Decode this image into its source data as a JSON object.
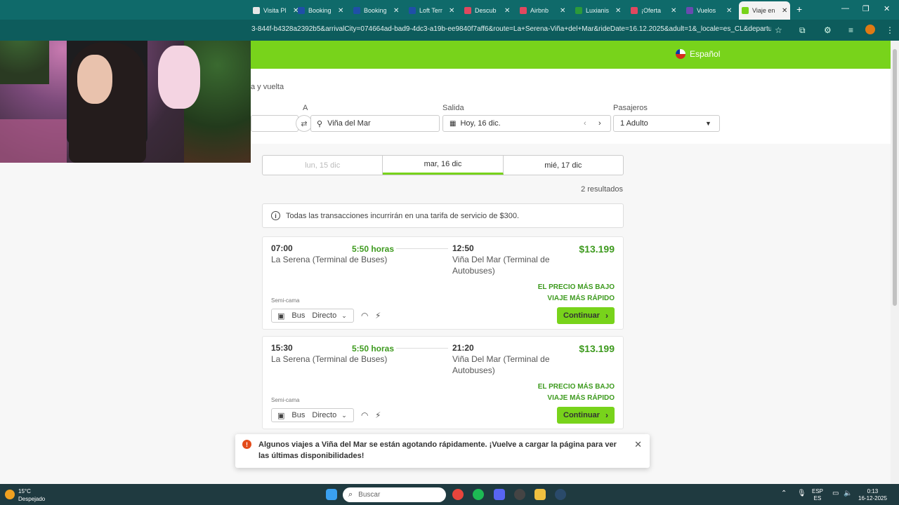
{
  "browser": {
    "tabs": [
      {
        "title": "Visita Pl",
        "color": "#e6e6e6"
      },
      {
        "title": "Booking",
        "color": "#1f4fa8"
      },
      {
        "title": "Booking",
        "color": "#1f4fa8"
      },
      {
        "title": "Loft Terr",
        "color": "#1f4fa8"
      },
      {
        "title": "Descub",
        "color": "#e0485f"
      },
      {
        "title": "Airbnb",
        "color": "#e0485f"
      },
      {
        "title": "Luxianis",
        "color": "#2c9a3a"
      },
      {
        "title": "¡Oferta",
        "color": "#e0485f"
      },
      {
        "title": "Vuelos",
        "color": "#6a4ab0"
      },
      {
        "title": "Viaje en",
        "color": "#78d31b"
      }
    ],
    "url": "3-844f-b4328a2392b5&arrivalCity=074664ad-bad9-4dc3-a19b-ee9840f7aff6&route=La+Serena-Viña+del+Mar&rideDate=16.12.2025&adult=1&_locale=es_CL&departureCoun..."
  },
  "header": {
    "language": "Español"
  },
  "search": {
    "trip_type": "a y vuelta",
    "to_label": "A",
    "to_value": "Viña del Mar",
    "departure_label": "Salida",
    "departure_value": "Hoy, 16 dic.",
    "passengers_label": "Pasajeros",
    "passengers_value": "1 Adulto"
  },
  "date_tabs": [
    {
      "label": "lun, 15 dic",
      "state": "disabled"
    },
    {
      "label": "mar, 16 dic",
      "state": "active"
    },
    {
      "label": "mié, 17 dic",
      "state": "normal"
    }
  ],
  "results_count": "2 resultados",
  "info_message": "Todas las transacciones incurrirán en una tarifa de servicio de $300.",
  "trips": [
    {
      "dep_time": "07:00",
      "duration": "5:50 horas",
      "arr_time": "12:50",
      "origin": "La Serena (Terminal de Buses)",
      "destination": "Viña Del Mar (Terminal de Autobuses)",
      "price": "$13.199",
      "tag1": "EL PRECIO MÁS BAJO",
      "tag2": "VIAJE MÁS RÁPIDO",
      "seat": "Semi-cama",
      "vehicle": "Bus",
      "route": "Directo",
      "button": "Continuar"
    },
    {
      "dep_time": "15:30",
      "duration": "5:50 horas",
      "arr_time": "21:20",
      "origin": "La Serena (Terminal de Buses)",
      "destination": "Viña Del Mar (Terminal de Autobuses)",
      "price": "$13.199",
      "tag1": "EL PRECIO MÁS BAJO",
      "tag2": "VIAJE MÁS RÁPIDO",
      "seat": "Semi-cama",
      "vehicle": "Bus",
      "route": "Directo",
      "button": "Continuar"
    }
  ],
  "toast": {
    "message": "Algunos viajes a Viña del Mar se están agotando rápidamente. ¡Vuelve a cargar la página para ver las últimas disponibilidades!"
  },
  "taskbar": {
    "temperature": "15°C",
    "weather": "Despejado",
    "search_placeholder": "Buscar",
    "lang1": "ESP",
    "lang2": "ES",
    "time": "0:13",
    "date": "16-12-2025"
  },
  "colors": {
    "brand": "#78d31b",
    "price_green": "#3d9a1e",
    "toast_alert": "#e34b1a"
  }
}
